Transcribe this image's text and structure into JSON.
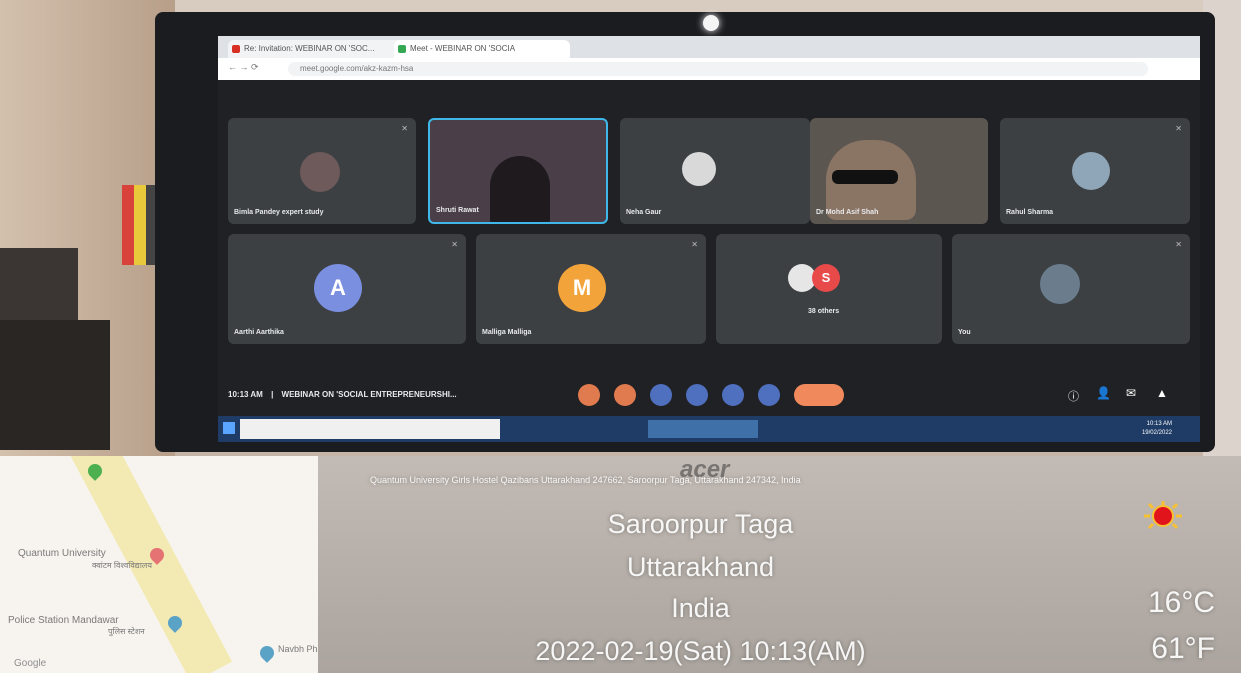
{
  "browser": {
    "tab1_label": "Re: Invitation: WEBINAR ON 'SOC...",
    "tab2_label": "Meet - WEBINAR ON 'SOCIA",
    "url": "meet.google.com/akz-kazm-hsa"
  },
  "participants": [
    {
      "name": "Bimla Pandey expert study"
    },
    {
      "name": "Shruti Rawat"
    },
    {
      "name": "Neha Gaur"
    },
    {
      "name": "Dr Mohd Asif Shah"
    },
    {
      "name": "Rahul Sharma"
    },
    {
      "name": "Aarthi Aarthika",
      "initial": "A",
      "color": "#7b8fe0"
    },
    {
      "name": "Malliga Malliga",
      "initial": "M",
      "color": "#f2a33a"
    },
    {
      "name": "38 others",
      "initial": "S",
      "color": "#e84a4a"
    },
    {
      "name": "You"
    }
  ],
  "meeting": {
    "time": "10:13 AM",
    "separator": "|",
    "title": "WEBINAR ON 'SOCIAL ENTREPRENEURSHI..."
  },
  "taskbar": {
    "clock_time": "10:13 AM",
    "clock_date": "19/02/2022"
  },
  "brand": "acer",
  "map": {
    "label1": "Quantum University",
    "label1_sub": "क्वांटम विश्वविद्यालय",
    "label2": "Police Station Mandawar",
    "label2_sub": "पुलिस स्टेशन",
    "label3": "Navbh Pharm",
    "logo": "Google"
  },
  "stamp": {
    "address": "Quantum University Girls Hostel Qazibans Uttarakhand 247662, Saroorpur Taga, Uttarakhand 247342, India",
    "city": "Saroorpur Taga",
    "state": "Uttarakhand",
    "country": "India",
    "datetime": "2022-02-19(Sat)   10:13(AM)",
    "temp_c": "16°C",
    "temp_f": "61°F"
  }
}
